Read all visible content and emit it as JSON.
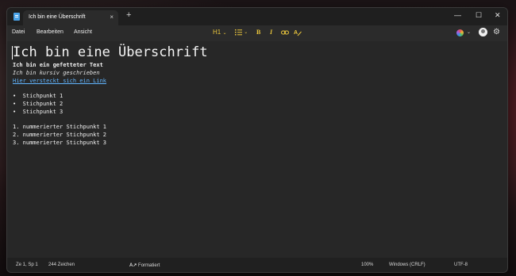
{
  "tab": {
    "title": "Ich bin eine Überschrift",
    "close": "×",
    "new_tab": "+"
  },
  "window_controls": {
    "minimize": "—",
    "maximize": "☐",
    "close": "✕"
  },
  "menu": {
    "items": [
      "Datei",
      "Bearbeiten",
      "Ansicht"
    ]
  },
  "format_toolbar": {
    "heading": "H1",
    "heading_chevron": "⌄",
    "list_chevron": "⌄",
    "list_icon": "list-icon",
    "bold": "B",
    "italic": "I",
    "link_icon": "link-icon",
    "clear_icon": "clear-format-icon"
  },
  "document": {
    "heading": "Ich bin eine Überschrift",
    "bold_line": "Ich bin ein gefetteter Text",
    "italic_line": "Ich bin kursiv geschrieben",
    "link_line": "Hier versteckt sich ein Link",
    "bullets": [
      "Stichpunkt 1",
      "Stichpunkt 2",
      "Stichpunkt 3"
    ],
    "numbered": [
      "nummerierter Stichpunkt 1",
      "nummerierter Stichpunkt 2",
      "nummerierter Stichpunkt 3"
    ],
    "bullet_glyph": "•",
    "number_prefixes": [
      "1.",
      "2.",
      "3."
    ]
  },
  "status": {
    "position": "Ze 1, Sp 1",
    "chars": "244 Zeichen",
    "format_mode": "Formatiert",
    "zoom": "100%",
    "line_ending": "Windows (CRLF)",
    "encoding": "UTF-8"
  },
  "colors": {
    "accent_format": "#e8c43c",
    "link": "#62b6ff",
    "background": "#272727"
  }
}
